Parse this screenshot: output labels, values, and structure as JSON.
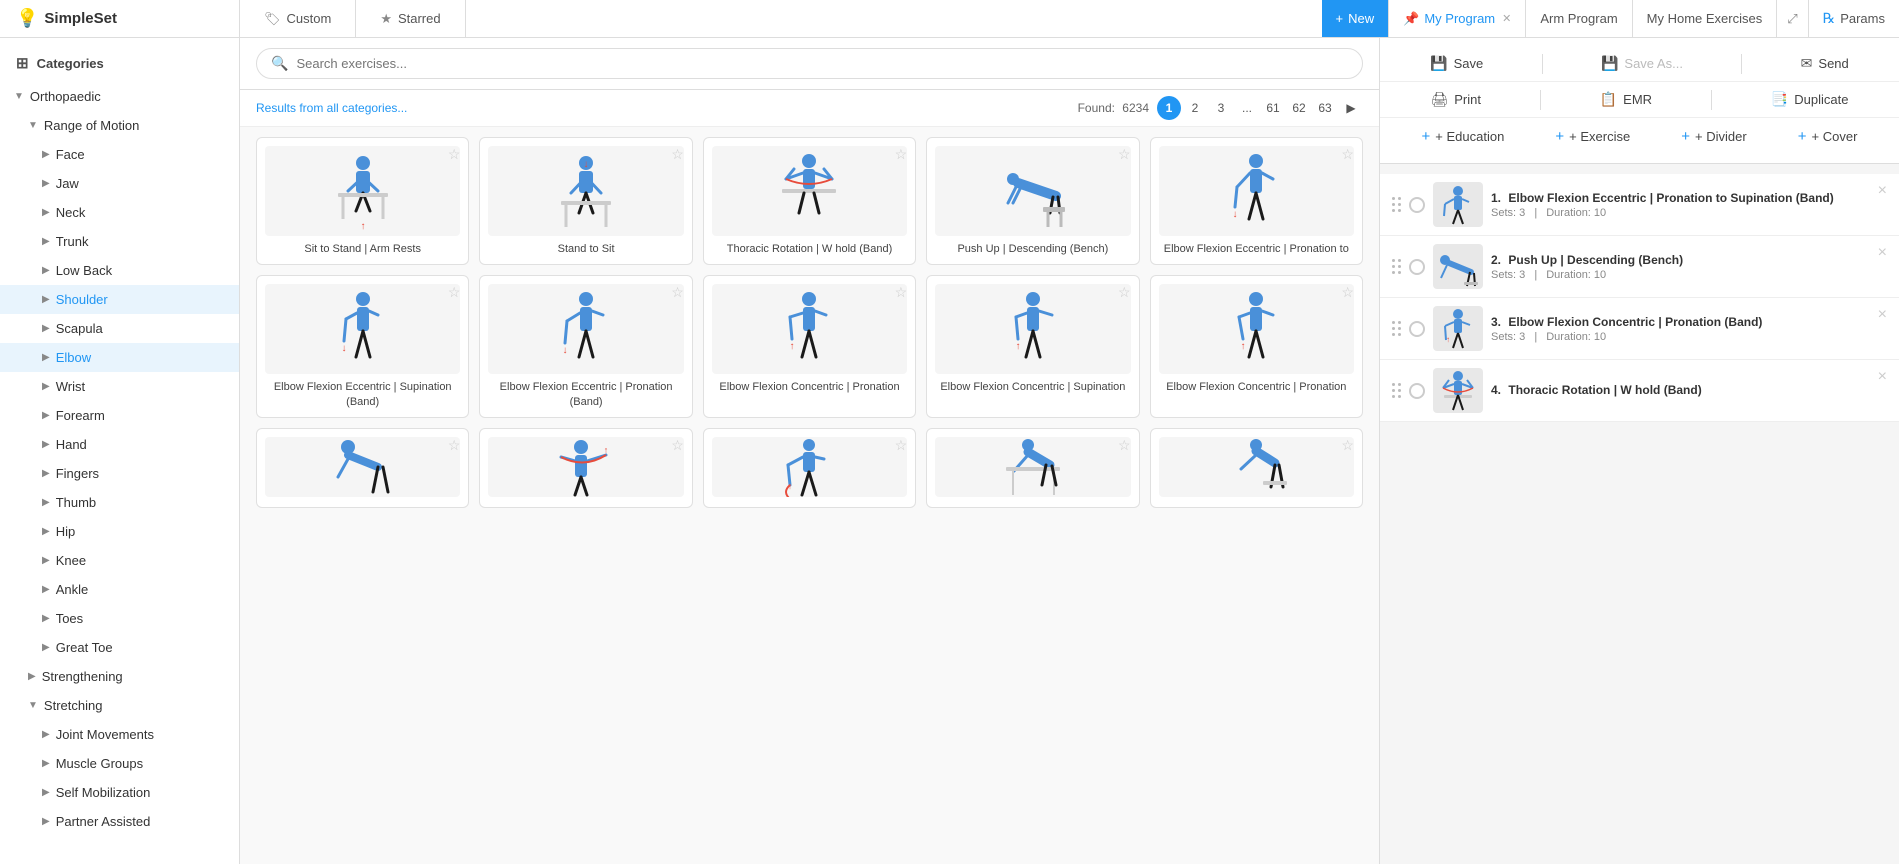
{
  "app": {
    "name": "SimpleSet"
  },
  "topnav": {
    "tabs": [
      {
        "id": "custom",
        "icon": "tag",
        "label": "Custom"
      },
      {
        "id": "starred",
        "icon": "star",
        "label": "Starred"
      }
    ],
    "new_label": "New",
    "my_program_label": "My Program",
    "arm_program_label": "Arm Program",
    "home_exercises_label": "My Home Exercises",
    "params_label": "Params"
  },
  "sidebar": {
    "header": "Categories",
    "tree": [
      {
        "id": "orthopaedic",
        "label": "Orthopaedic",
        "level": 1,
        "expanded": true,
        "chevron": "▼"
      },
      {
        "id": "rom",
        "label": "Range of Motion",
        "level": 2,
        "expanded": true,
        "chevron": "▼"
      },
      {
        "id": "face",
        "label": "Face",
        "level": 3,
        "chevron": "▶"
      },
      {
        "id": "jaw",
        "label": "Jaw",
        "level": 3,
        "chevron": "▶"
      },
      {
        "id": "neck",
        "label": "Neck",
        "level": 3,
        "chevron": "▶"
      },
      {
        "id": "trunk",
        "label": "Trunk",
        "level": 3,
        "chevron": "▶"
      },
      {
        "id": "lowback",
        "label": "Low Back",
        "level": 3,
        "chevron": "▶"
      },
      {
        "id": "shoulder",
        "label": "Shoulder",
        "level": 3,
        "chevron": "▶",
        "active": true
      },
      {
        "id": "scapula",
        "label": "Scapula",
        "level": 3,
        "chevron": "▶"
      },
      {
        "id": "elbow",
        "label": "Elbow",
        "level": 3,
        "chevron": "▶",
        "active": true
      },
      {
        "id": "wrist",
        "label": "Wrist",
        "level": 3,
        "chevron": "▶"
      },
      {
        "id": "forearm",
        "label": "Forearm",
        "level": 3,
        "chevron": "▶"
      },
      {
        "id": "hand",
        "label": "Hand",
        "level": 3,
        "chevron": "▶"
      },
      {
        "id": "fingers",
        "label": "Fingers",
        "level": 3,
        "chevron": "▶"
      },
      {
        "id": "thumb",
        "label": "Thumb",
        "level": 3,
        "chevron": "▶"
      },
      {
        "id": "hip",
        "label": "Hip",
        "level": 3,
        "chevron": "▶"
      },
      {
        "id": "knee",
        "label": "Knee",
        "level": 3,
        "chevron": "▶"
      },
      {
        "id": "ankle",
        "label": "Ankle",
        "level": 3,
        "chevron": "▶"
      },
      {
        "id": "toes",
        "label": "Toes",
        "level": 3,
        "chevron": "▶"
      },
      {
        "id": "greattoe",
        "label": "Great Toe",
        "level": 3,
        "chevron": "▶"
      },
      {
        "id": "strengthening",
        "label": "Strengthening",
        "level": 2,
        "expanded": false,
        "chevron": "▶"
      },
      {
        "id": "stretching",
        "label": "Stretching",
        "level": 2,
        "expanded": true,
        "chevron": "▼"
      },
      {
        "id": "jointmov",
        "label": "Joint Movements",
        "level": 3,
        "chevron": "▶"
      },
      {
        "id": "musclegroups",
        "label": "Muscle Groups",
        "level": 3,
        "chevron": "▶"
      },
      {
        "id": "selfmob",
        "label": "Self Mobilization",
        "level": 3,
        "chevron": "▶"
      },
      {
        "id": "partnerasst",
        "label": "Partner Assisted",
        "level": 3,
        "chevron": "▶"
      }
    ]
  },
  "search": {
    "placeholder": "Search exercises...",
    "value": "",
    "results_link": "Results from all categories...",
    "found_label": "Found:",
    "found_count": "6234",
    "pages": [
      "1",
      "2",
      "3",
      "...",
      "61",
      "62",
      "63"
    ],
    "current_page": "1"
  },
  "exercises": {
    "rows": [
      [
        {
          "id": "e1",
          "title": "Sit to Stand | Arm Rests",
          "starred": false
        },
        {
          "id": "e2",
          "title": "Stand to Sit",
          "starred": false
        },
        {
          "id": "e3",
          "title": "Thoracic Rotation | W hold (Band)",
          "starred": false
        },
        {
          "id": "e4",
          "title": "Push Up | Descending (Bench)",
          "starred": false
        },
        {
          "id": "e5",
          "title": "Elbow Flexion Eccentric | Pronation to",
          "starred": false
        }
      ],
      [
        {
          "id": "e6",
          "title": "Elbow Flexion Eccentric | Supination (Band)",
          "starred": false
        },
        {
          "id": "e7",
          "title": "Elbow Flexion Eccentric | Pronation (Band)",
          "starred": false
        },
        {
          "id": "e8",
          "title": "Elbow Flexion Concentric | Pronation",
          "starred": false
        },
        {
          "id": "e9",
          "title": "Elbow Flexion Concentric | Supination",
          "starred": false
        },
        {
          "id": "e10",
          "title": "Elbow Flexion Concentric | Pronation",
          "starred": false
        }
      ],
      [
        {
          "id": "e11",
          "title": "",
          "starred": false
        },
        {
          "id": "e12",
          "title": "",
          "starred": false
        },
        {
          "id": "e13",
          "title": "",
          "starred": false
        },
        {
          "id": "e14",
          "title": "",
          "starred": false
        },
        {
          "id": "e15",
          "title": "",
          "starred": false
        }
      ]
    ]
  },
  "right_toolbar": {
    "save_label": "Save",
    "save_as_label": "Save As...",
    "send_label": "Send",
    "print_label": "Print",
    "emr_label": "EMR",
    "duplicate_label": "Duplicate",
    "add_education_label": "+ Education",
    "add_exercise_label": "+ Exercise",
    "add_divider_label": "+ Divider",
    "add_cover_label": "+ Cover"
  },
  "program": {
    "items": [
      {
        "num": "1.",
        "title": "Elbow Flexion Eccentric | Pronation to Supination (Band)",
        "sets": "Sets: 3",
        "duration": "Duration: 10"
      },
      {
        "num": "2.",
        "title": "Push Up | Descending (Bench)",
        "sets": "Sets: 3",
        "duration": "Duration: 10"
      },
      {
        "num": "3.",
        "title": "Elbow Flexion Concentric | Pronation (Band)",
        "sets": "Sets: 3",
        "duration": "Duration: 10"
      },
      {
        "num": "4.",
        "title": "Thoracic Rotation | W hold (Band)",
        "sets": "",
        "duration": ""
      }
    ]
  },
  "colors": {
    "accent": "#2196F3",
    "text_primary": "#333",
    "text_secondary": "#888",
    "border": "#ddd",
    "bg_light": "#f5f5f5"
  }
}
